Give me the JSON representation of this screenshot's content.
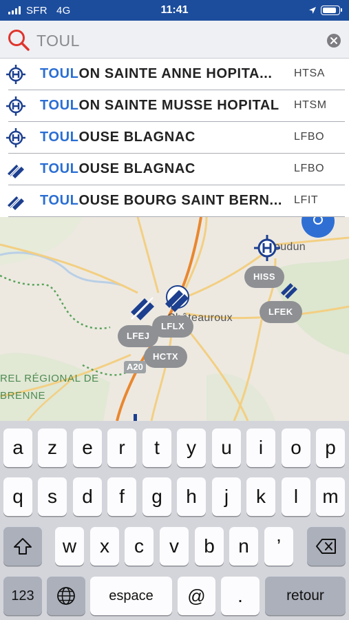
{
  "status_bar": {
    "carrier": "SFR",
    "network": "4G",
    "time": "11:41"
  },
  "search": {
    "value": "TOUL",
    "placeholder": ""
  },
  "results": [
    {
      "match": "TOUL",
      "rest": "ON SAINTE ANNE HOPITA...",
      "code": "HTSA",
      "icon": "heliport-icon"
    },
    {
      "match": "TOUL",
      "rest": "ON SAINTE MUSSE HOPITAL",
      "code": "HTSM",
      "icon": "heliport-icon"
    },
    {
      "match": "TOUL",
      "rest": "OUSE BLAGNAC",
      "code": "LFBO",
      "icon": "heliport-icon"
    },
    {
      "match": "TOUL",
      "rest": "OUSE BLAGNAC",
      "code": "LFBO",
      "icon": "airport-icon"
    },
    {
      "match": "TOUL",
      "rest": "OUSE BOURG SAINT BERN...",
      "code": "LFIT",
      "icon": "airport-icon"
    }
  ],
  "map": {
    "labels": {
      "oudun": "oudun",
      "chateauroux": "Châteauroux",
      "parc_line1": "REL RÉGIONAL DE",
      "parc_line2": "BRENNE",
      "road": "A20"
    },
    "pills": {
      "hiss": "HISS",
      "lfek": "LFEK",
      "lflx": "LFLX",
      "lfej": "LFEJ",
      "hctx": "HCTX"
    }
  },
  "keyboard": {
    "row1": [
      "a",
      "z",
      "e",
      "r",
      "t",
      "y",
      "u",
      "i",
      "o",
      "p"
    ],
    "row2": [
      "q",
      "s",
      "d",
      "f",
      "g",
      "h",
      "j",
      "k",
      "l",
      "m"
    ],
    "row3": [
      "w",
      "x",
      "c",
      "v",
      "b",
      "n",
      "’"
    ],
    "numbers_label": "123",
    "space_label": "espace",
    "at_label": "@",
    "period_label": ".",
    "return_label": "retour"
  },
  "colors": {
    "status_bar_bg": "#1c4d9d",
    "match_text": "#2a6ed3",
    "pill_bg": "#8e9094",
    "aviation_blue": "#1c3f8f",
    "search_red": "#e0342c"
  }
}
